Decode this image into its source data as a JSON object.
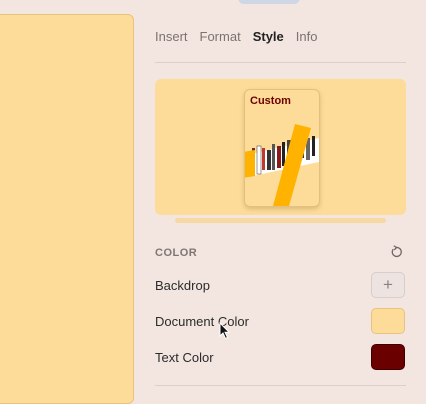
{
  "tabs": [
    {
      "label": "Insert",
      "active": false
    },
    {
      "label": "Format",
      "active": false
    },
    {
      "label": "Style",
      "active": true
    },
    {
      "label": "Info",
      "active": false
    }
  ],
  "preview": {
    "thumbnail_title": "Custom"
  },
  "color_section": {
    "heading": "COLOR",
    "reset_icon": "reset-icon",
    "rows": [
      {
        "label": "Backdrop",
        "swatch": "add",
        "icon": "plus-icon"
      },
      {
        "label": "Document Color",
        "swatch_color": "#fddc9a"
      },
      {
        "label": "Text Color",
        "swatch_color": "#6b0000"
      }
    ]
  },
  "colors": {
    "canvas_background": "#fddc9a",
    "panel_background": "#f3e6e1",
    "accent_yellow": "#ffb300"
  }
}
